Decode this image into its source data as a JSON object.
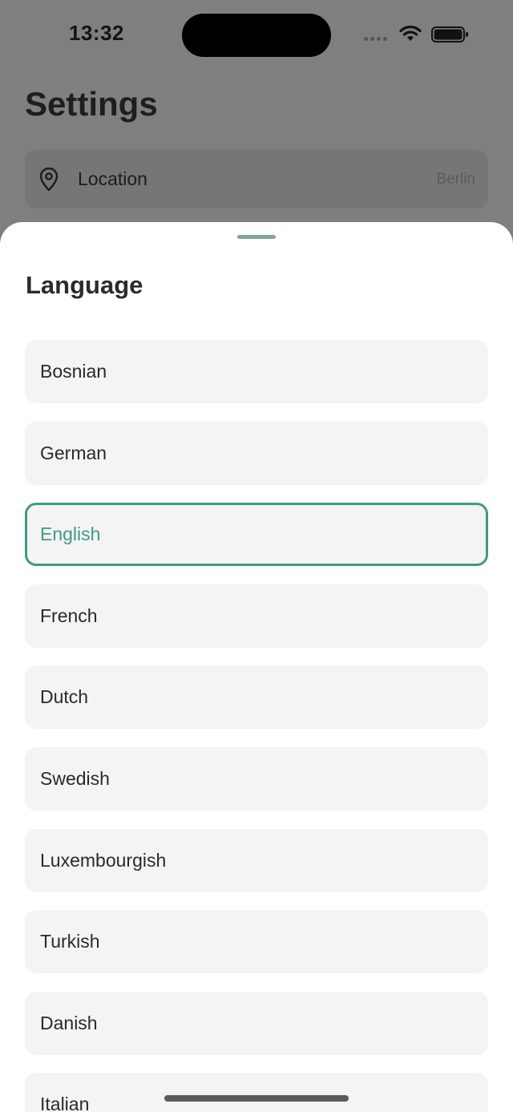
{
  "status_bar": {
    "time": "13:32"
  },
  "background_page": {
    "title": "Settings",
    "location_row": {
      "label": "Location",
      "value": "Berlin",
      "icon": "location-pin-icon"
    }
  },
  "language_sheet": {
    "title": "Language",
    "selected": "English",
    "accent_color": "#3f9a88",
    "options": [
      {
        "label": "Bosnian"
      },
      {
        "label": "German"
      },
      {
        "label": "English"
      },
      {
        "label": "French"
      },
      {
        "label": "Dutch"
      },
      {
        "label": "Swedish"
      },
      {
        "label": "Luxembourgish"
      },
      {
        "label": "Turkish"
      },
      {
        "label": "Danish"
      },
      {
        "label": "Italian"
      }
    ]
  }
}
